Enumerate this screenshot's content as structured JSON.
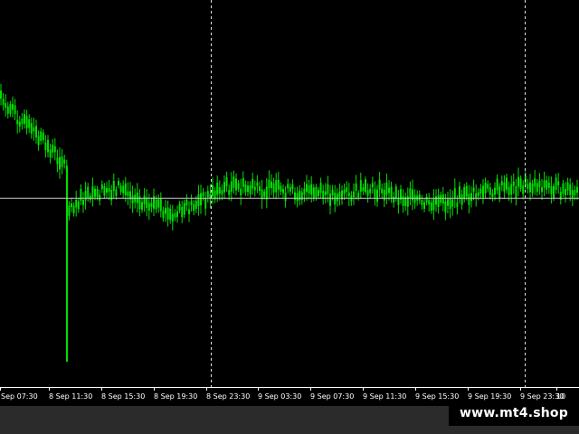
{
  "chart_data": {
    "type": "line",
    "title": "",
    "xlabel": "",
    "ylabel": "",
    "candle_color": "#00e000",
    "background_color": "#000000",
    "grid": false,
    "x_ticks": [
      "Sep 07:30",
      "8 Sep 11:30",
      "8 Sep 15:30",
      "8 Sep 19:30",
      "8 Sep 23:30",
      "9 Sep 03:30",
      "9 Sep 07:30",
      "9 Sep 11:30",
      "9 Sep 15:30",
      "9 Sep 19:30",
      "9 Sep 23:30",
      "10"
    ],
    "period_separators": [
      "8 Sep 23:30",
      "9 Sep 23:30"
    ],
    "ylim": [
      0,
      100
    ],
    "horizontal_level": 49,
    "series": [
      {
        "x": [
          "Sep 07:30",
          "8 Sep 11:30",
          "8 Sep 15:30",
          "8 Sep 19:30",
          "8 Sep 23:30",
          "9 Sep 03:30",
          "9 Sep 07:30",
          "9 Sep 11:30",
          "9 Sep 15:30",
          "9 Sep 19:30",
          "9 Sep 23:30",
          "10"
        ],
        "values": [
          75,
          47,
          52,
          44,
          52,
          51,
          50,
          51,
          47,
          51,
          53,
          50
        ]
      }
    ]
  },
  "watermark": {
    "text": "www.mt4.shop"
  }
}
